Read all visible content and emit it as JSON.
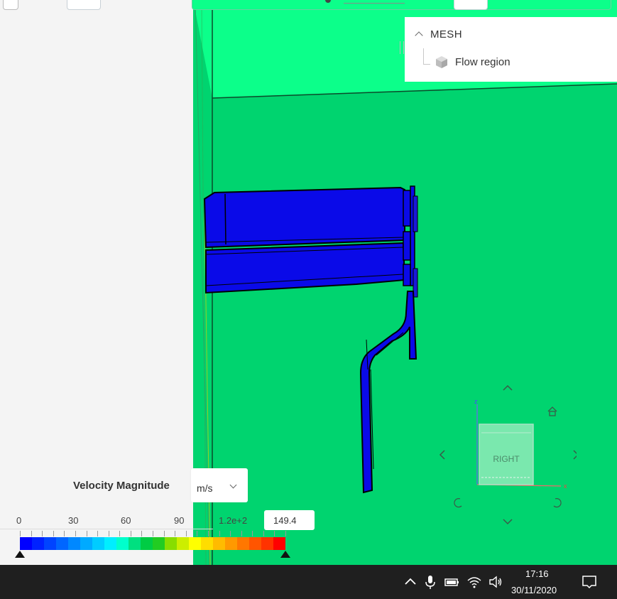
{
  "mesh_tree": {
    "title": "MESH",
    "items": [
      {
        "label": "Flow region",
        "icon": "cube-icon"
      }
    ]
  },
  "view_cube": {
    "face_label": "RIGHT",
    "axes": {
      "z": "z",
      "x": "x"
    }
  },
  "legend": {
    "quantity_label": "Velocity Magnitude",
    "unit": "m/s",
    "ticks": [
      "0",
      "30",
      "60",
      "90",
      "1.2e+2"
    ],
    "max_value": "149.4",
    "colors": [
      "#0000ff",
      "#0022ff",
      "#0044ff",
      "#0066ff",
      "#0088ff",
      "#00aaff",
      "#00ccff",
      "#00eeff",
      "#00ffcc",
      "#00e080",
      "#00cc44",
      "#22cc22",
      "#88dd00",
      "#ccee00",
      "#ffff00",
      "#ffdd00",
      "#ffbb00",
      "#ff9900",
      "#ff7700",
      "#ff5500",
      "#ff3300",
      "#ff0000"
    ]
  },
  "taskbar": {
    "time": "17:16",
    "date": "30/11/2020"
  },
  "colors": {
    "viewport_green": "#00d46f",
    "domain_top": "#0cff8a",
    "part_blue": "#1a1ae0",
    "panel_bg": "#f4f4f4",
    "taskbar_bg": "#1f1f1f"
  }
}
